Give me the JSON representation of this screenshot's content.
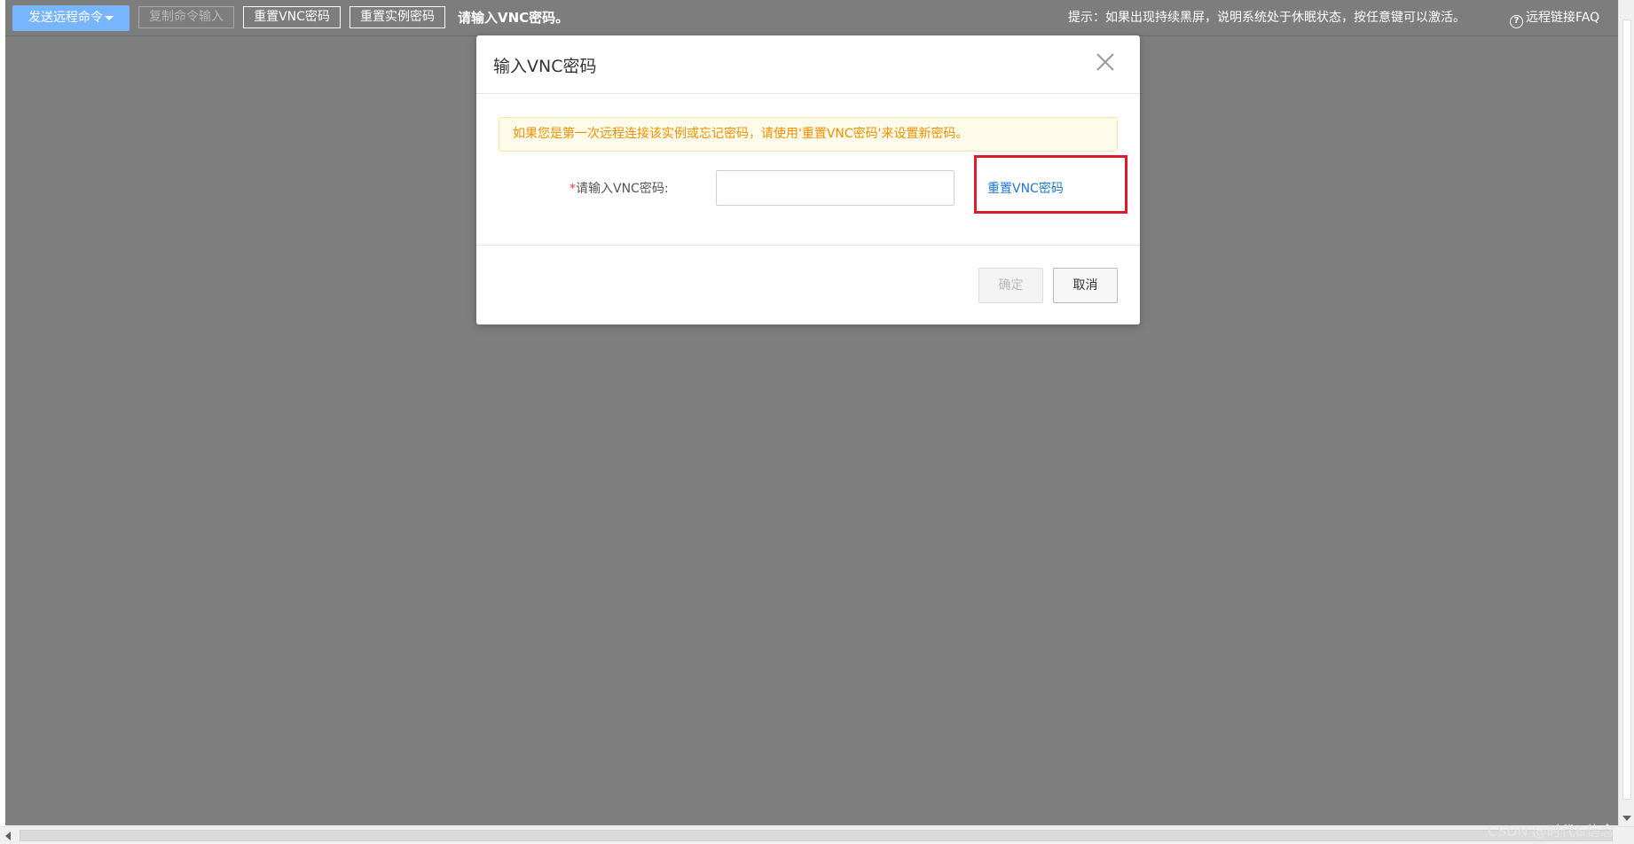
{
  "toolbar": {
    "send_command": "发送远程命令",
    "copy_command_input": "复制命令输入",
    "reset_vnc_password": "重置VNC密码",
    "reset_instance_password": "重置实例密码",
    "status_message": "请输入VNC密码。",
    "tip": "提示：如果出现持续黑屏，说明系统处于休眠状态，按任意键可以激活。",
    "faq_icon": "?",
    "faq_label": "远程链接FAQ"
  },
  "dialog": {
    "title": "输入VNC密码",
    "notice": "如果您是第一次远程连接该实例或忘记密码，请使用'重置VNC密码'来设置新密码。",
    "required_mark": "*",
    "password_label": "请输入VNC密码:",
    "password_value": "",
    "password_placeholder": "",
    "reset_link": "重置VNC密码",
    "confirm_button": "确定",
    "cancel_button": "取消"
  },
  "watermark": "CSDN @时代&信念",
  "colors": {
    "toolbar_bg": "#7d7d7d",
    "primary_button": "#77b6ff",
    "screen_bg": "#7f7f7f",
    "notice_text": "#f08f00",
    "notice_bg": "#fffbea",
    "link": "#1c78d5",
    "highlight": "#e0192a",
    "required": "#e8443b"
  },
  "icons": {
    "close": "close-icon",
    "dropdown": "caret-down-icon",
    "help": "help-circle-icon"
  }
}
